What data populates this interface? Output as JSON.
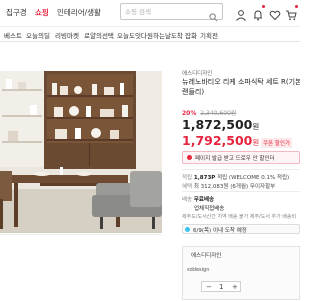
{
  "header": {
    "categories": [
      {
        "label": "집구경",
        "active": false
      },
      {
        "label": "쇼핑",
        "active": true
      },
      {
        "label": "인테리어/생활",
        "active": false
      }
    ],
    "search": {
      "placeholder": "쇼핑 검색"
    },
    "icons": [
      "user-icon",
      "bell-icon",
      "heart-icon",
      "cart-icon"
    ]
  },
  "nav": {
    "items": [
      "베스트",
      "오늘의딜",
      "리빙마켓",
      "로얄의선택",
      "오늘도잇다",
      "원하는날도착",
      "잡화",
      "기획전"
    ]
  },
  "product": {
    "store": "에스디디자인",
    "name_line1": "뉴레노바티오 리케 소파식탁 세트 R(기본형)(",
    "name_line2": "랜들리)",
    "discount": "20%",
    "original_price": "2,340,600원",
    "price": "1,872,500",
    "price_unit": "원",
    "coupon_price": "1,792,500",
    "coupon_unit": "원",
    "coupon_tag": "쿠폰 할인가",
    "benefit_banner": "페이지 발급 받고 드로우 안 할인더",
    "points_label": "적립",
    "points_value": "1,873P",
    "points_note": "적립 (WELCOME 0.1% 적립)",
    "card_label": "혜택",
    "card_value": "최 312,083원 (6개월) 무이자할부",
    "shipping_label": "배송",
    "shipping_value": "무료배송",
    "shipping_note": "업체직접배송",
    "shipping_mini": "제주도/도서산간 지역 배송 불가  제주/도서 추가 배송비",
    "delivery_button": "6/9(목) 이내 도착 예정",
    "option": {
      "name": "에스디디자인",
      "logo": "sddesign",
      "quantity": "1",
      "minus": "−",
      "plus": "+"
    }
  },
  "colors": {
    "accent": "#e6243e",
    "text": "#222222",
    "muted": "#999999",
    "brand_blue": "#35c5f0"
  }
}
